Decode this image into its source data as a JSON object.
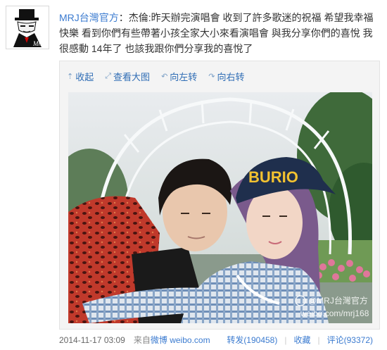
{
  "post": {
    "author": "MRJ台灣官方",
    "colon": "：",
    "text": "杰倫:昨天辦完演唱會 收到了許多歌迷的祝福 希望我幸福快樂 看到你們有些帶著小孩全家大小來看演唱會 與我分享你們的喜悅 我很感動 14年了 也該我跟你們分享我的喜悅了"
  },
  "toolbar": {
    "collapse": "收起",
    "view_large": "查看大图",
    "rotate_left": "向左转",
    "rotate_right": "向右转"
  },
  "photo": {
    "cap_text": "BURIO",
    "watermark_name": "@MRJ台灣官方",
    "watermark_url": "weibo.com/mrj168"
  },
  "footer": {
    "time": "2014-11-17 03:09",
    "source_prefix": "来自",
    "source": "微博 weibo.com",
    "repost": "转发(190458)",
    "favorite": "收藏",
    "comment": "评论(93372)"
  },
  "colors": {
    "link": "#3b7bd0",
    "author": "#3b7bd0"
  }
}
